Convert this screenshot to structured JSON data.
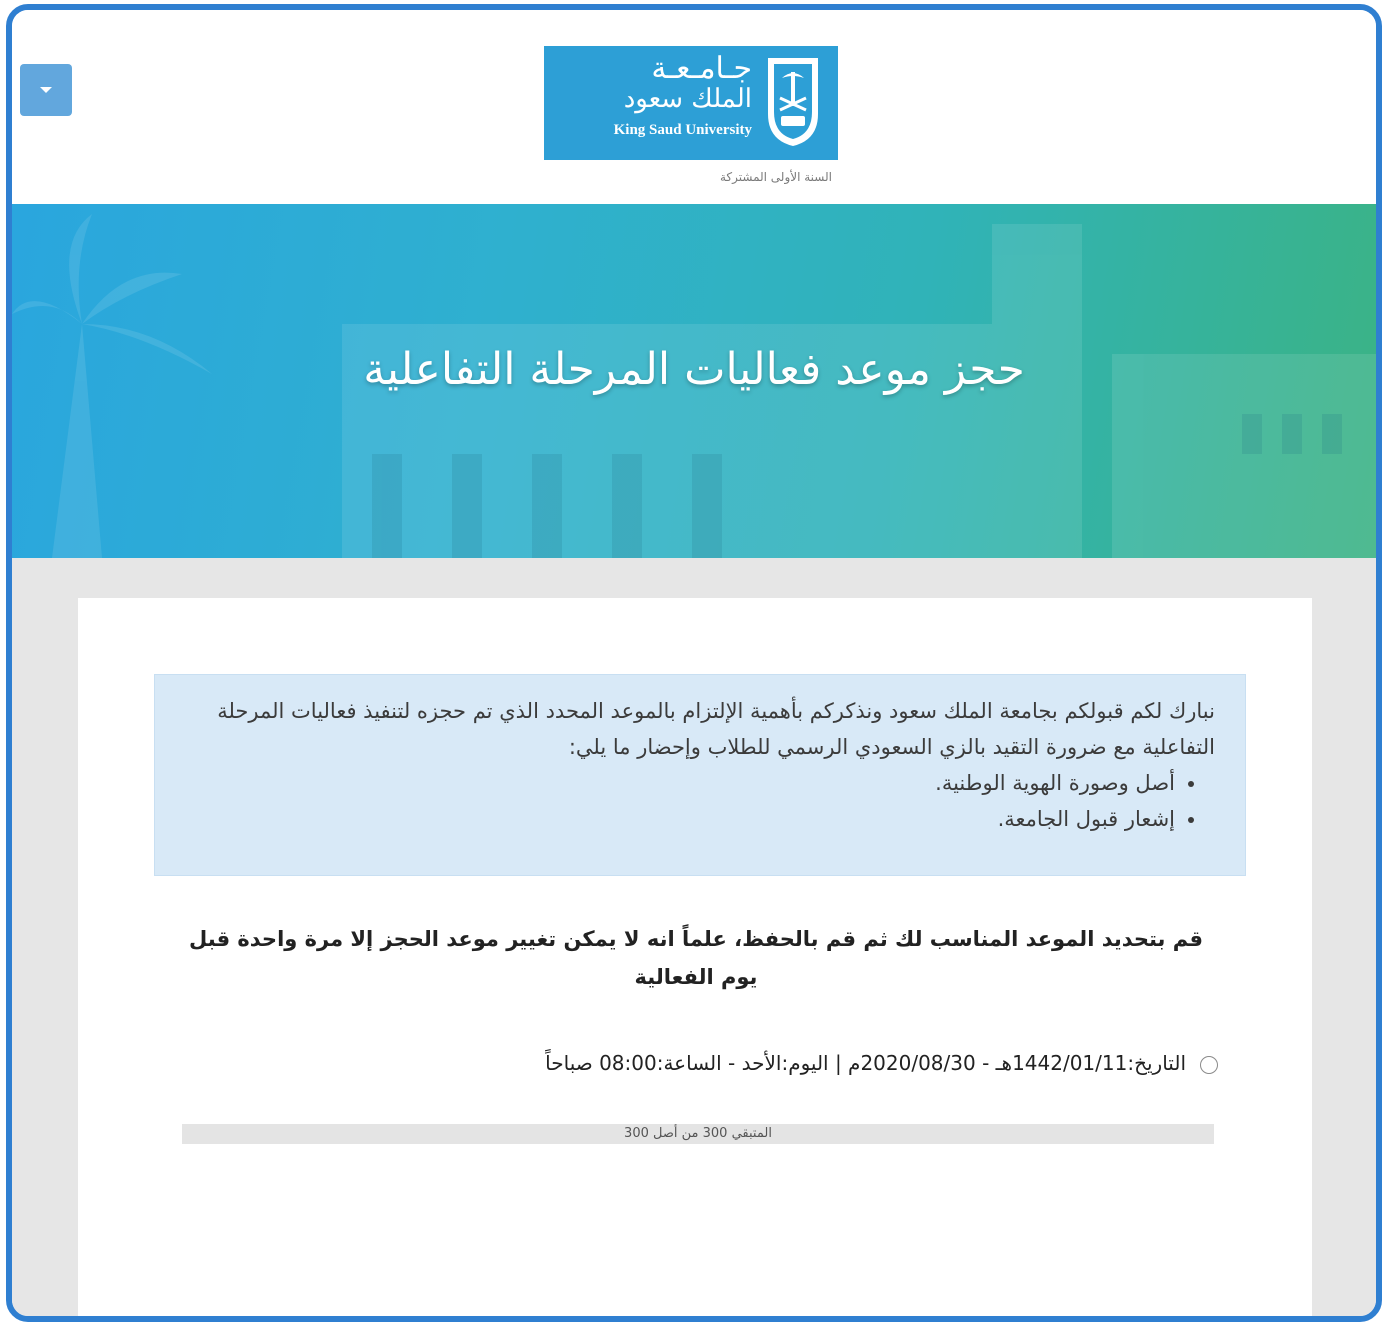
{
  "header": {
    "logo_ar_line1": "جـامـعـة",
    "logo_ar_line2": "الملك سعود",
    "logo_en": "King Saud University",
    "subtitle": "السنة الأولى المشتركة",
    "menu_icon": "chevron-down-icon"
  },
  "banner": {
    "title": "حجز موعد فعاليات المرحلة التفاعلية"
  },
  "notice": {
    "text": "نبارك لكم قبولكم بجامعة الملك سعود ونذكركم بأهمية الإلتزام بالموعد المحدد الذي تم حجزه لتنفيذ فعاليات المرحلة التفاعلية مع ضرورة التقيد بالزي السعودي الرسمي للطلاب وإحضار ما يلي:",
    "items": [
      "أصل وصورة الهوية الوطنية.",
      "إشعار قبول الجامعة."
    ]
  },
  "instruction": "قم بتحديد الموعد المناسب لك ثم قم بالحفظ، علماً انه لا يمكن تغيير موعد الحجز إلا مرة واحدة قبل يوم الفعالية",
  "slot": {
    "label": "التاريخ:1442/01/11هـ - 2020/08/30م | اليوم:الأحد - الساعة:08:00 صباحاً",
    "availability": "المتبقي 300 من أصل 300",
    "remaining_fraction": 1.0
  },
  "colors": {
    "frame": "#2f7fd1",
    "logo_bg": "#2d9fd6",
    "notice_bg": "#d8e9f7",
    "button": "#62a7dd"
  }
}
